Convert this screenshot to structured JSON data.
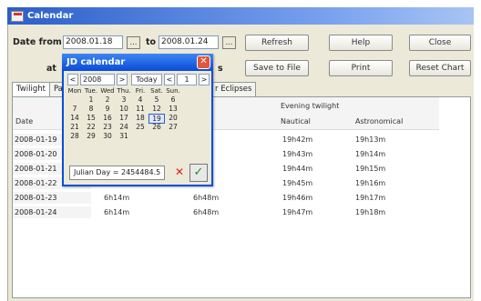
{
  "window": {
    "title": "Calendar"
  },
  "form": {
    "date_from_label": "Date from",
    "date_from_value": "2008.01.18",
    "to_label": "to",
    "date_to_value": "2008.01.24",
    "at_label": "at",
    "s_label": "s"
  },
  "buttons": {
    "refresh": "Refresh",
    "help": "Help",
    "close": "Close",
    "save_to_file": "Save to File",
    "print": "Print",
    "reset_chart": "Reset Chart"
  },
  "tabs": [
    {
      "label": "Twilight"
    },
    {
      "label": "Par"
    },
    {
      "label": "r Eclipses"
    }
  ],
  "table": {
    "date_header": "Date",
    "group_header": "Evening twilight",
    "nautical_header": "Nautical",
    "astronomical_header": "Astronomical",
    "rows": [
      {
        "date": "2008-01-19",
        "c1": "",
        "c2": "",
        "nautical": "19h42m",
        "astro": "19h13m"
      },
      {
        "date": "2008-01-20",
        "c1": "",
        "c2": "",
        "nautical": "19h43m",
        "astro": "19h14m"
      },
      {
        "date": "2008-01-21",
        "c1": "",
        "c2": "",
        "nautical": "19h44m",
        "astro": "19h15m"
      },
      {
        "date": "2008-01-22",
        "c1": "",
        "c2": "",
        "nautical": "19h45m",
        "astro": "19h16m"
      },
      {
        "date": "2008-01-23",
        "c1": "6h14m",
        "c2": "6h48m",
        "nautical": "19h46m",
        "astro": "19h17m"
      },
      {
        "date": "2008-01-24",
        "c1": "6h14m",
        "c2": "6h48m",
        "nautical": "19h47m",
        "astro": "19h18m"
      }
    ]
  },
  "jd_calendar": {
    "title": "JD calendar",
    "year": "2008",
    "today_label": "Today",
    "month": "1",
    "prev": "<",
    "next": ">",
    "weekdays": [
      "Mon",
      "Tue.",
      "Wed",
      "Thu.",
      "Fri.",
      "Sat.",
      "Sun."
    ],
    "weeks": [
      [
        "",
        "1",
        "2",
        "3",
        "4",
        "5",
        "6"
      ],
      [
        "7",
        "8",
        "9",
        "10",
        "11",
        "12",
        "13"
      ],
      [
        "14",
        "15",
        "16",
        "17",
        "18",
        "19",
        "20"
      ],
      [
        "21",
        "22",
        "23",
        "24",
        "25",
        "26",
        "27"
      ],
      [
        "28",
        "29",
        "30",
        "31",
        "",
        "",
        ""
      ]
    ],
    "selected_day": "19",
    "julian_day_text": "Julian Day = 2454484.5"
  }
}
